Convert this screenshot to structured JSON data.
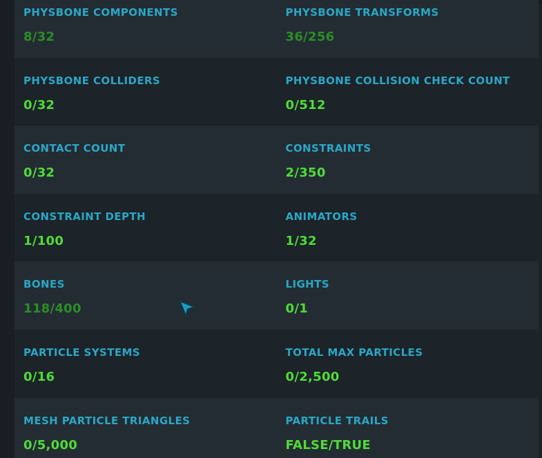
{
  "stats": [
    [
      {
        "label": "PHYSBONE COMPONENTS",
        "value": "8/32",
        "status": "warn"
      },
      {
        "label": "PHYSBONE TRANSFORMS",
        "value": "36/256",
        "status": "warn"
      }
    ],
    [
      {
        "label": "PHYSBONE COLLIDERS",
        "value": "0/32",
        "status": "ok"
      },
      {
        "label": "PHYSBONE COLLISION CHECK COUNT",
        "value": "0/512",
        "status": "ok"
      }
    ],
    [
      {
        "label": "CONTACT COUNT",
        "value": "0/32",
        "status": "ok"
      },
      {
        "label": "CONSTRAINTS",
        "value": "2/350",
        "status": "ok"
      }
    ],
    [
      {
        "label": "CONSTRAINT DEPTH",
        "value": "1/100",
        "status": "ok"
      },
      {
        "label": "ANIMATORS",
        "value": "1/32",
        "status": "ok"
      }
    ],
    [
      {
        "label": "BONES",
        "value": "118/400",
        "status": "warn"
      },
      {
        "label": "LIGHTS",
        "value": "0/1",
        "status": "ok"
      }
    ],
    [
      {
        "label": "PARTICLE SYSTEMS",
        "value": "0/16",
        "status": "ok"
      },
      {
        "label": "TOTAL MAX PARTICLES",
        "value": "0/2,500",
        "status": "ok"
      }
    ],
    [
      {
        "label": "MESH PARTICLE TRIANGLES",
        "value": "0/5,000",
        "status": "ok"
      },
      {
        "label": "PARTICLE TRAILS",
        "value": "FALSE/TRUE",
        "status": "ok"
      }
    ]
  ],
  "colors": {
    "label": "#2aa7c6",
    "value_ok": "#4fdc37",
    "value_warn": "#2b8e25",
    "row_alt": "#242c33",
    "row_base": "#1c2329"
  },
  "icons": {
    "cursor": "pointer-arrow-icon"
  }
}
